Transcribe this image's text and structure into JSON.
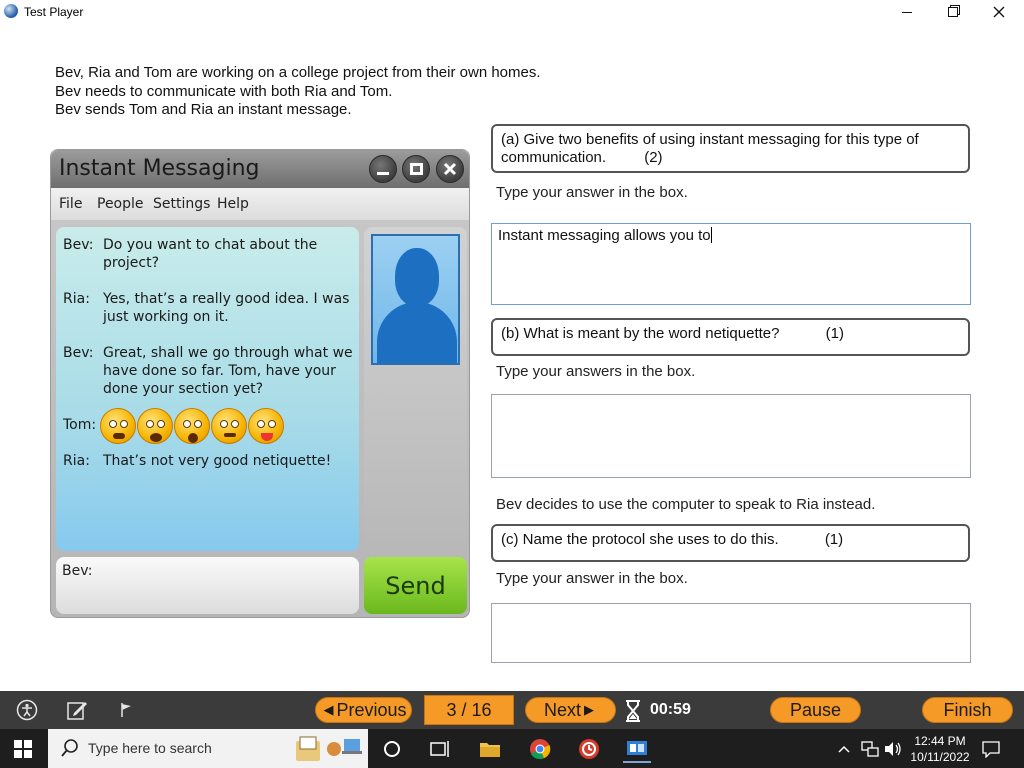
{
  "window": {
    "title": "Test Player",
    "min_icon": "minimize-icon",
    "max_icon": "restore-icon",
    "close_icon": "close-icon"
  },
  "intro": {
    "line1": "Bev, Ria and Tom are working on a college project from their own homes.",
    "line2": "Bev needs to communicate with both Ria and Tom.",
    "line3": "Bev sends Tom and Ria an instant message."
  },
  "im": {
    "title": "Instant Messaging",
    "menu": [
      "File",
      "People",
      "Settings",
      "Help"
    ],
    "messages": [
      {
        "who": "Bev:",
        "text": "Do you want to chat about the project?"
      },
      {
        "who": "Ria:",
        "text": "Yes, that’s a really good idea. I was just working on it."
      },
      {
        "who": "Bev:",
        "text": "Great, shall we go through what we have done so far. Tom, have your done your section yet?"
      },
      {
        "who": "Tom:",
        "text": ""
      },
      {
        "who": "Ria:",
        "text": "That’s not very good netiquette!"
      }
    ],
    "emojis": [
      "frowning-emoji-icon",
      "angry-emoji-icon",
      "shocked-emoji-icon",
      "grimacing-emoji-icon",
      "tongue-out-emoji-icon"
    ],
    "compose_label": "Bev:",
    "send_label": "Send"
  },
  "questions": {
    "a": {
      "text": "(a) Give two benefits of using instant messaging for this type of communication.",
      "marks": "(2)",
      "hint": "Type your answer in the box.",
      "answer": "Instant messaging allows you to"
    },
    "b": {
      "text": "(b) What is meant by the word netiquette?",
      "marks": "(1)",
      "hint": "Type your answers in the box.",
      "answer": ""
    },
    "c_intro": "Bev decides to use the computer to speak to Ria instead.",
    "c": {
      "text": "(c) Name the protocol she uses to do this.",
      "marks": "(1)",
      "hint": "Type your answer in the box.",
      "answer": ""
    }
  },
  "toolbar": {
    "previous_label": "Previous",
    "counter": "3 / 16",
    "next_label": "Next",
    "timer": "00:59",
    "pause_label": "Pause",
    "finish_label": "Finish",
    "accent": "#f59a27"
  },
  "taskbar": {
    "search_placeholder": "Type here to search",
    "time": "12:44 PM",
    "date": "10/11/2022"
  }
}
